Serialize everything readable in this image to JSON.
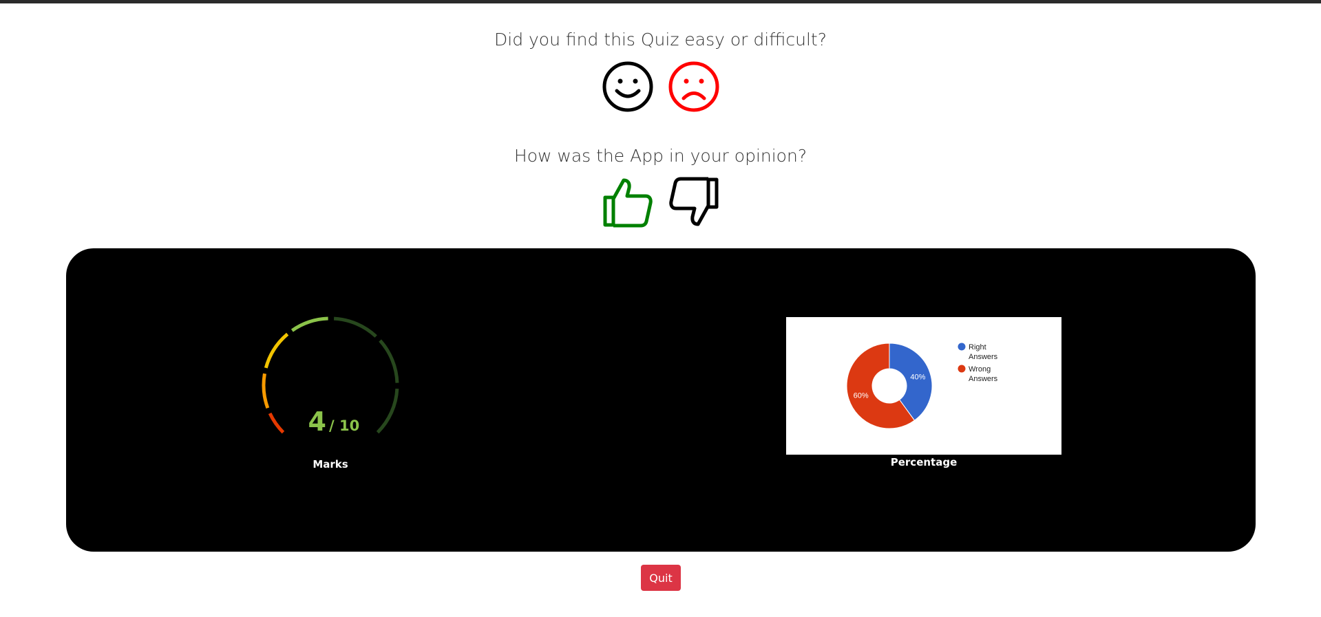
{
  "feedback": {
    "difficulty_question": "Did you find this Quiz easy or difficult?",
    "opinion_question": "How was the App in your opinion?",
    "icons": {
      "easy": "smile-icon",
      "difficult": "frown-icon",
      "like": "thumbs-up-icon",
      "dislike": "thumbs-down-icon"
    },
    "colors": {
      "easy": "#000000",
      "difficult": "#ff0000",
      "like": "#008000",
      "dislike": "#000000"
    }
  },
  "results": {
    "marks": {
      "score": "4",
      "out_of": "/ 10",
      "score_value": 4,
      "max_value": 10,
      "caption": "Marks"
    },
    "percentage_caption": "Percentage"
  },
  "chart_data": {
    "type": "pie",
    "categories": [
      "Right Answers",
      "Wrong Answers"
    ],
    "values": [
      40,
      60
    ],
    "labels": [
      "40%",
      "60%"
    ],
    "colors": [
      "#3366cc",
      "#dc3912"
    ],
    "donut": true,
    "legend_position": "right"
  },
  "colors": {
    "gauge_value": "#8bc34a",
    "quit": "#dc3545"
  },
  "actions": {
    "quit_label": "Quit"
  }
}
